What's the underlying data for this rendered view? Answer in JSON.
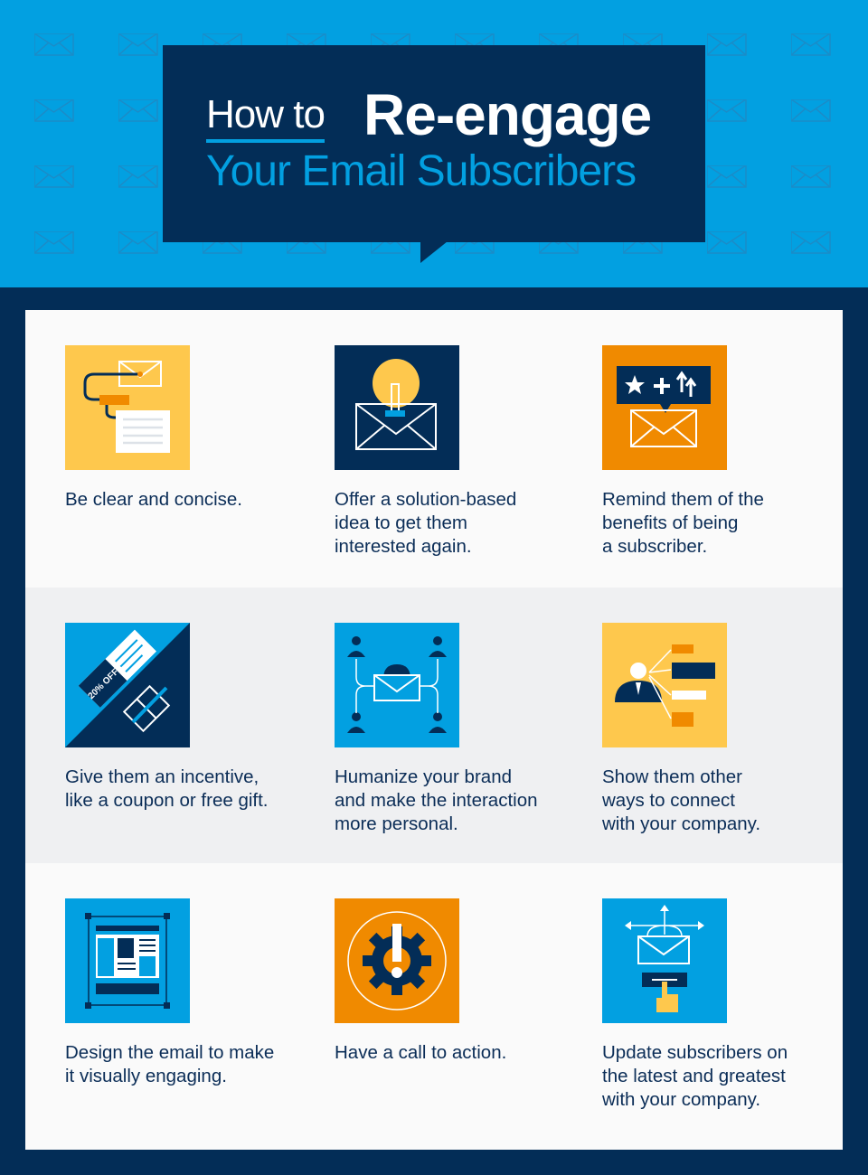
{
  "header": {
    "title_prefix": "How to",
    "title_main": "Re-engage",
    "subtitle": "Your Email Subscribers"
  },
  "colors": {
    "sky_blue": "#02a0e1",
    "navy": "#032d57",
    "yellow": "#fec84d",
    "orange": "#f08a00"
  },
  "tips": [
    {
      "text": "Be clear and concise.",
      "icon": "email-document-icon"
    },
    {
      "text": "Offer a solution-based\nidea to get them\ninterested again.",
      "icon": "lightbulb-envelope-icon"
    },
    {
      "text": "Remind them of the\nbenefits of being\na subscriber.",
      "icon": "benefits-envelope-icon"
    },
    {
      "text": "Give them an incentive,\nlike a coupon or free gift.",
      "icon": "coupon-gift-icon",
      "coupon_text": "20% OFF"
    },
    {
      "text": "Humanize your brand\nand make the interaction\nmore personal.",
      "icon": "people-envelope-icon"
    },
    {
      "text": "Show them other\nways to connect\nwith your company.",
      "icon": "person-connections-icon"
    },
    {
      "text": "Design the email to make\nit visually engaging.",
      "icon": "layout-design-icon"
    },
    {
      "text": "Have a call to action.",
      "icon": "gear-exclamation-icon"
    },
    {
      "text": "Update subscribers on\nthe latest and greatest\nwith your company.",
      "icon": "envelope-click-icon"
    }
  ]
}
